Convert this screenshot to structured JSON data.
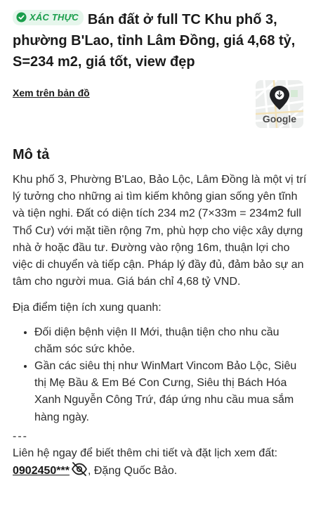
{
  "listing": {
    "badge": {
      "icon": "verified-check-icon",
      "label": "XÁC THỰC",
      "color": "#1a9e4b"
    },
    "title": "Bán đất ở full TC Khu phố 3, phường B'Lao, tỉnh Lâm Đồng, giá 4,68 tỷ, S=234 m2, giá tốt, view đẹp"
  },
  "map": {
    "link_label": "Xem trên bản đồ",
    "thumbnail_logo": "Google",
    "pin_icon": "map-pin-icon"
  },
  "description": {
    "heading": "Mô tả",
    "paragraph": "Khu phố 3, Phường B'Lao, Bảo Lộc, Lâm Đồng là một vị trí lý tưởng cho những ai tìm kiếm không gian sống yên tĩnh và tiện nghi. Đất có diện tích 234 m2 (7×33m = 234m2 full Thổ Cư) với mặt tiền rộng 7m, phù hợp cho việc xây dựng nhà ở hoặc đầu tư. Đường vào rộng 16m, thuận lợi cho việc di chuyển và tiếp cận. Pháp lý đầy đủ, đảm bảo sự an tâm cho người mua. Giá bán chỉ 4,68 tỷ VND.",
    "amenities_heading": "Địa điểm tiện ích xung quanh:",
    "amenities": [
      "Đối diện bệnh viện II Mới, thuận tiện cho nhu cầu chăm sóc sức khỏe.",
      "Gần các siêu thị như WinMart Vincom Bảo Lộc, Siêu thị Mẹ Bầu & Em Bé Con Cưng, Siêu thị Bách Hóa Xanh Nguyễn Công Trứ, đáp ứng nhu cầu mua sắm hàng ngày."
    ],
    "separator": "---",
    "contact_prefix": "Liên hệ ngay để biết thêm chi tiết và đặt lịch xem đất: ",
    "phone_masked": "0902450***",
    "reveal_icon": "eye-off-icon",
    "contact_suffix": ", Đặng Quốc Bảo."
  }
}
